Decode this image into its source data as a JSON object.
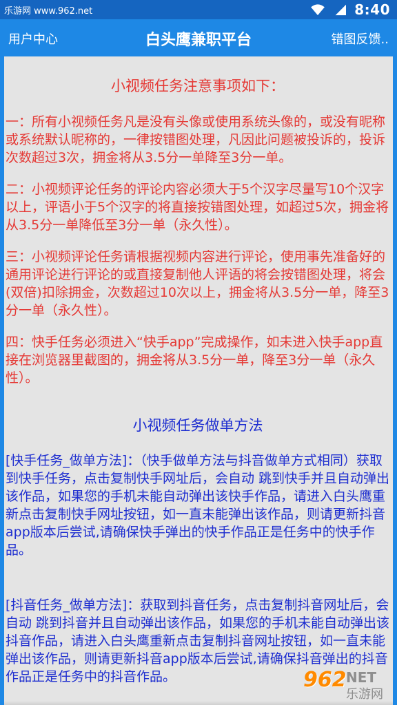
{
  "status_bar": {
    "source_text": "乐游网 www.962.net",
    "time": "8:40",
    "icons": [
      "wifi-icon",
      "signal-icon"
    ]
  },
  "app_bar": {
    "left_label": "用户中心",
    "title": "白头鹰兼职平台",
    "right_label": "错图反馈.."
  },
  "notice": {
    "title": "小视频任务注意事项如下：",
    "items": [
      "一：所有小视频任务凡是没有头像或使用系统头像的，或没有昵称或系统默认昵称的，一律按错图处理，凡因此问题被投诉的，投诉次数超过3次，拥金将从3.5分一单降至3分一单。",
      "二：小视频评论任务的评论内容必须大于5个汉字尽量写10个汉字以上，评语小于5个汉字的将直接按错图处理，如超过5次，拥金将从3.5分一单降低至3分一单（永久性）。",
      "三：小视频评论任务请根据视频内容进行评论，使用事先准备好的通用评论进行评论的或直接复制他人评语的将会按错图处理，将会(双倍)扣除拥金，次数超过10次以上，拥金将从3.5分一单，降至3分一单（永久性）。",
      "四：快手任务必须进入“快手app”完成操作，如未进入快手app直接在浏览器里截图的，拥金将从3.5分一单，降至3分一单（永久性）。"
    ]
  },
  "method": {
    "title": "小视频任务做单方法",
    "items": [
      "[快手任务_做单方法]：（快手做单方法与抖音做单方式相同）获取到快手任务，点击复制快手网址后，会自动 跳到快手并且自动弹出该作品，如果您的手机未能自动弹出该快手作品，请进入白头鹰重新点击复制快手网址按钮，如一直未能弹出该作品，则请更新抖音app版本后尝试,请确保快手弹出的快手作品正是任务中的快手作品。",
      "[抖音任务_做单方法]：获取到抖音任务，点击复制抖音网址后，会自动 跳到抖音并且自动弹出该作品，如果您的手机未能自动弹出该抖音作品，请进入白头鹰重新点击复制抖音网址按钮，如一直未能弹出该作品，则请更新抖音app版本后尝试,请确保抖音弹出的抖音作品正是任务中的抖音作品。"
    ]
  },
  "watermark": {
    "brand": "962",
    "suffix": "NET",
    "cn": "乐游网"
  },
  "colors": {
    "app_bar": "#1e88e5",
    "status_bar": "#1565c0",
    "content_bg": "#e4e4e4",
    "notice_text": "#e53935",
    "method_text": "#1f2fd0"
  }
}
